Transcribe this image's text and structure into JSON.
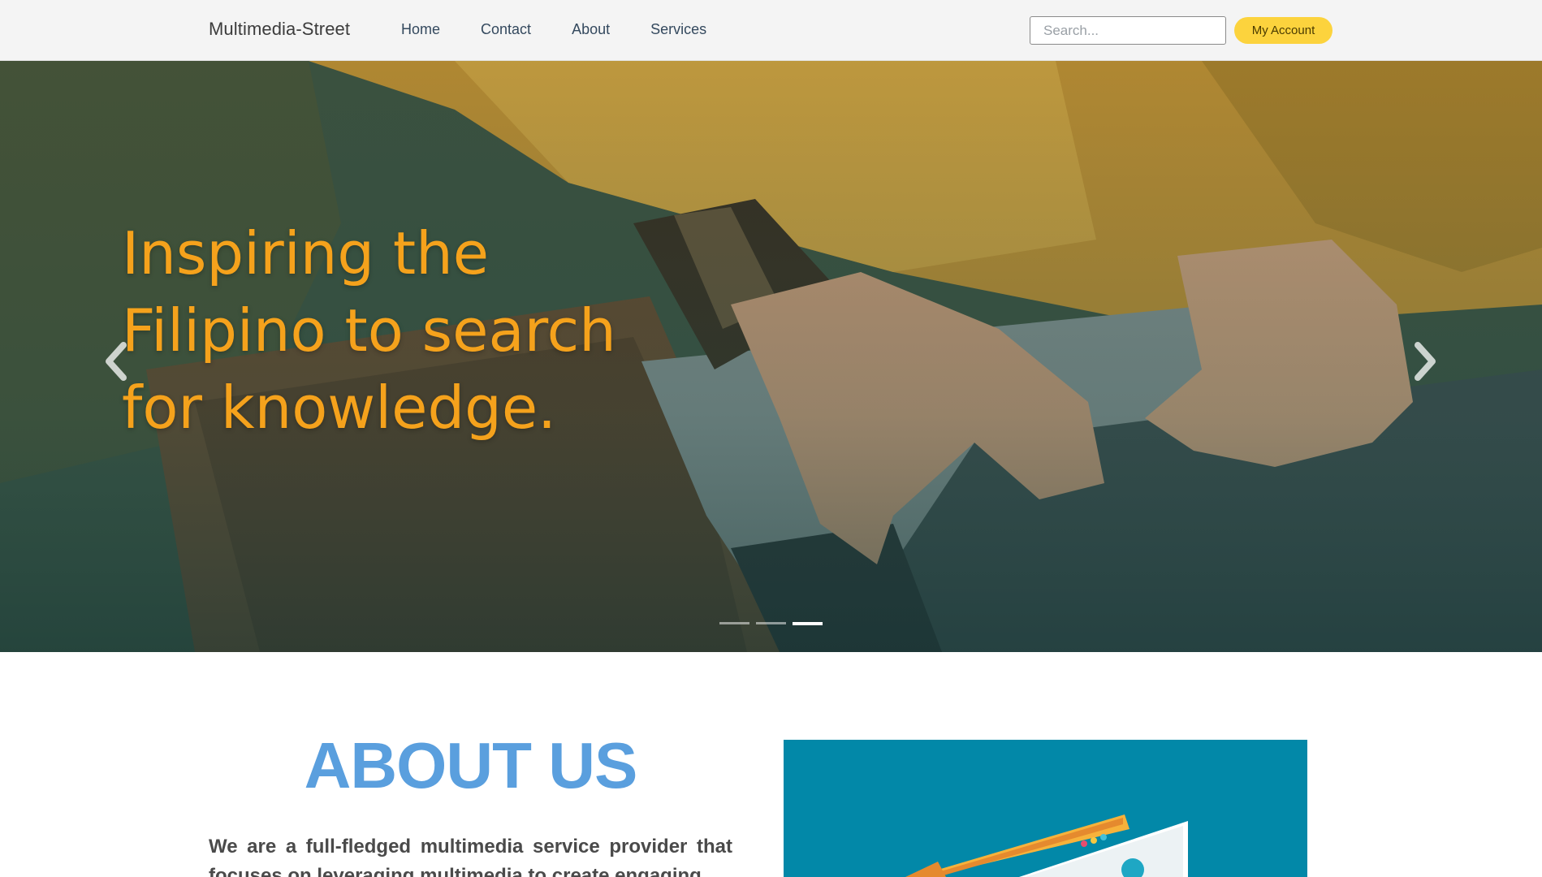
{
  "navbar": {
    "brand": "Multimedia-Street",
    "links": [
      "Home",
      "Contact",
      "About",
      "Services"
    ],
    "search_placeholder": "Search...",
    "account_label": "My Account"
  },
  "hero": {
    "title": "Inspiring the\nFilipino to search\nfor knowledge.",
    "slide_count": 3,
    "active_slide": 3,
    "title_color": "#f5a21c"
  },
  "about": {
    "heading": "ABOUT US",
    "text": "We are a full-fledged multimedia service provider that focuses on leveraging multimedia to create engaging",
    "heading_color": "#5a9fde",
    "image_bg": "#0288a8"
  },
  "icons": {
    "prev": "chevron-left-icon",
    "next": "chevron-right-icon"
  }
}
